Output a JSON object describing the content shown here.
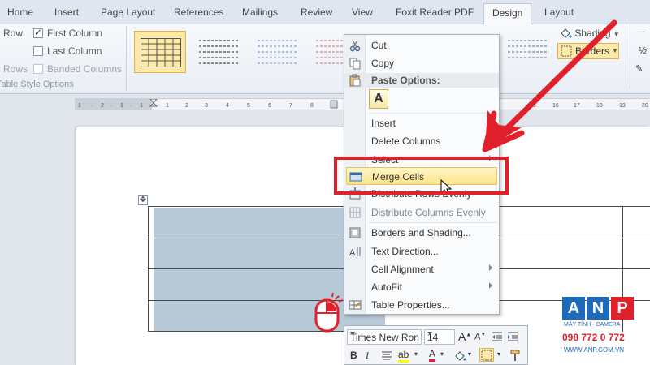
{
  "tabs": [
    {
      "label": "Home"
    },
    {
      "label": "Insert"
    },
    {
      "label": "Page Layout"
    },
    {
      "label": "References"
    },
    {
      "label": "Mailings"
    },
    {
      "label": "Review"
    },
    {
      "label": "View"
    },
    {
      "label": "Foxit Reader PDF"
    },
    {
      "label": "Design",
      "active": true
    },
    {
      "label": "Layout"
    }
  ],
  "style_options": {
    "header_row": "Row",
    "first_column": "First Column",
    "total_row": "Rows",
    "last_column": "Last Column",
    "banded_rows": "Rows",
    "banded_columns": "Banded Columns",
    "group_label": "Table Style Options",
    "first_column_checked": true
  },
  "ribbon_right": {
    "shading": "Shading",
    "borders": "Borders",
    "pen_weight": "½"
  },
  "context_menu": {
    "cut": "Cut",
    "copy": "Copy",
    "paste_options": "Paste Options:",
    "paste_keep_text": "A",
    "insert": "Insert",
    "delete_columns": "Delete Columns",
    "select": "Select",
    "merge_cells": "Merge Cells",
    "distribute_rows": "Distribute Rows Evenly",
    "distribute_columns": "Distribute Columns Evenly",
    "borders_shading": "Borders and Shading...",
    "text_direction": "Text Direction...",
    "cell_alignment": "Cell Alignment",
    "autofit": "AutoFit",
    "table_properties": "Table Properties..."
  },
  "mini_toolbar": {
    "font": "Times New Ron",
    "size": "14"
  },
  "watermark": {
    "letters": [
      "A",
      "N",
      "P"
    ],
    "tagline": "MÁY TÍNH · CAMERA",
    "phone": "098 772 0 772",
    "url": "WWW.ANP.COM.VN"
  },
  "colors": {
    "annotation_red": "#e0202a",
    "selection_fill": "#b8c9d8",
    "menu_highlight": "#fde58a"
  }
}
